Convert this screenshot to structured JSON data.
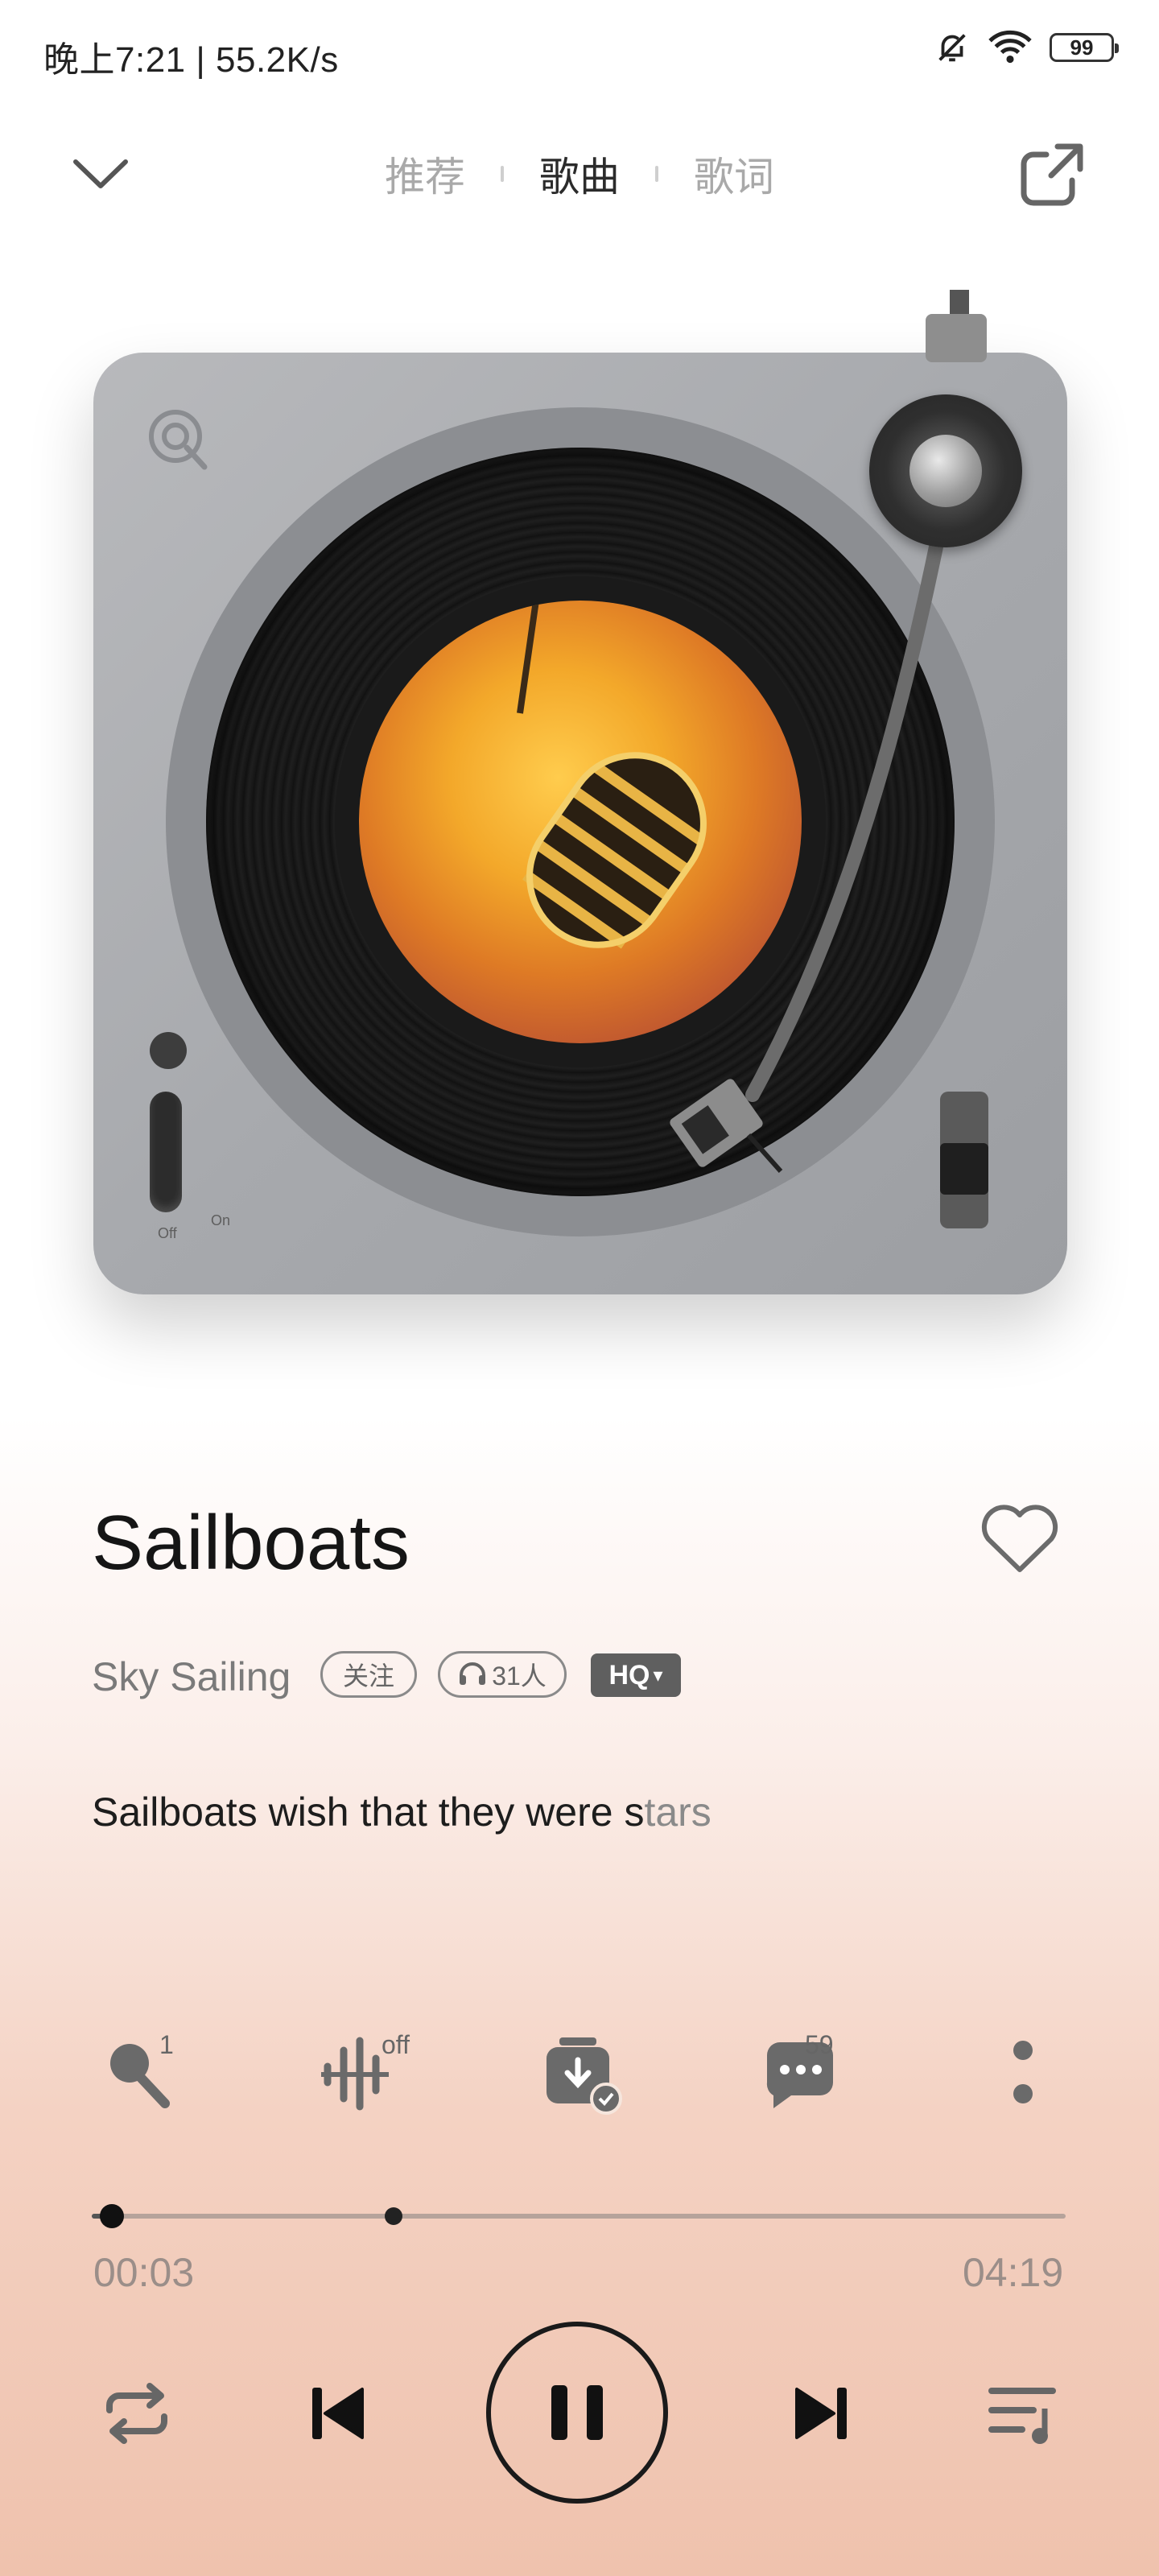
{
  "status_bar": {
    "time_speed": "晚上7:21 | 55.2K/s",
    "battery": "99"
  },
  "header": {
    "tabs": [
      {
        "label": "推荐",
        "active": false
      },
      {
        "label": "歌曲",
        "active": true
      },
      {
        "label": "歌词",
        "active": false
      }
    ]
  },
  "turntable": {
    "power_off_label": "Off",
    "power_on_label": "On"
  },
  "song": {
    "title": "Sailboats",
    "artist": "Sky Sailing",
    "follow_label": "关注",
    "listeners": "31人",
    "quality": "HQ",
    "lyric_sung": "Sailboats wish that they were s",
    "lyric_unsung": "tars"
  },
  "actions": {
    "karaoke_count": "1",
    "effect_state": "off",
    "comment_count": "59"
  },
  "progress": {
    "elapsed": "00:03",
    "total": "04:19",
    "fraction": 0.012,
    "buffered": 0.31
  },
  "colors": {
    "accent_dark": "#1a1a1a",
    "gradient_bottom": "#efc2ad"
  },
  "icons": [
    "bell-off-icon",
    "wifi-icon",
    "battery-icon",
    "chevron-down-icon",
    "share-icon",
    "heart-icon",
    "microphone-icon",
    "sound-effect-icon",
    "download-icon",
    "comment-icon",
    "more-icon",
    "repeat-icon",
    "previous-icon",
    "pause-icon",
    "next-icon",
    "playlist-icon"
  ]
}
